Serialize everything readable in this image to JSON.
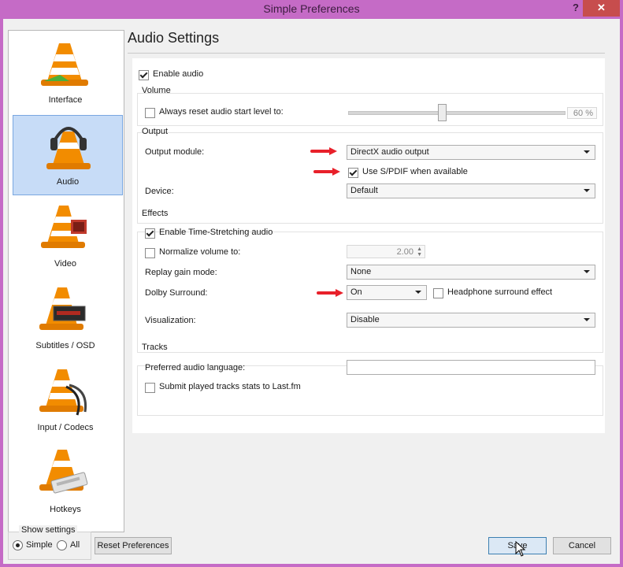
{
  "window": {
    "title": "Simple Preferences",
    "help_glyph": "?",
    "close_glyph": "✕",
    "frame_color": "#c56bc6"
  },
  "sidebar": {
    "items": [
      {
        "label": "Interface",
        "icon": "vlc-cone-icon",
        "selected": false
      },
      {
        "label": "Audio",
        "icon": "headphones-cone-icon",
        "selected": true
      },
      {
        "label": "Video",
        "icon": "film-cone-icon",
        "selected": false
      },
      {
        "label": "Subtitles / OSD",
        "icon": "subtitles-cone-icon",
        "selected": false
      },
      {
        "label": "Input / Codecs",
        "icon": "cable-cone-icon",
        "selected": false
      },
      {
        "label": "Hotkeys",
        "icon": "keyboard-cone-icon",
        "selected": false
      }
    ],
    "selection_color": "#c7dcf7"
  },
  "page": {
    "heading": "Audio Settings"
  },
  "audio": {
    "enable_audio": {
      "label": "Enable audio",
      "checked": true
    },
    "volume": {
      "group": "Volume",
      "reset_label": "Always reset audio start level to:",
      "reset_checked": false,
      "level_text": "60 %",
      "level": 0.6
    },
    "output": {
      "group": "Output",
      "module_label": "Output module:",
      "module_value": "DirectX audio output",
      "spdif_label": "Use S/PDIF when available",
      "spdif_checked": true,
      "device_label": "Device:",
      "device_value": "Default"
    },
    "effects": {
      "group": "Effects",
      "timestretch_label": "Enable Time-Stretching audio",
      "timestretch_checked": true,
      "normalize_label": "Normalize volume to:",
      "normalize_checked": false,
      "normalize_value": "2.00",
      "replay_label": "Replay gain mode:",
      "replay_value": "None",
      "dolby_label": "Dolby Surround:",
      "dolby_value": "On",
      "headphone_label": "Headphone surround effect",
      "headphone_checked": false,
      "vis_label": "Visualization:",
      "vis_value": "Disable"
    },
    "tracks": {
      "group": "Tracks",
      "lang_label": "Preferred audio language:",
      "lang_value": "",
      "lastfm_label": "Submit played tracks stats to Last.fm",
      "lastfm_checked": false
    }
  },
  "annotation": {
    "arrow_color": "#e8202a"
  },
  "footer": {
    "show_settings": "Show settings",
    "simple": "Simple",
    "all": "All",
    "simple_selected": true,
    "reset_button": "Reset Preferences",
    "save_button": "Save",
    "cancel_button": "Cancel"
  }
}
